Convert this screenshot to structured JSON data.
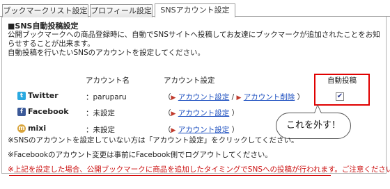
{
  "tabs": [
    {
      "label": "ブックマークリスト設定",
      "active": false
    },
    {
      "label": "プロフィール設定",
      "active": false
    },
    {
      "label": "SNSアカウント設定",
      "active": true
    }
  ],
  "section": {
    "title": "■SNS自動投稿設定",
    "desc_line1": "公開ブックマークへの商品登録時に、自動でSNSサイトへ投稿してお友達にブックマークが追加されたことをお知らせすることが出来ます。",
    "desc_line2": "自動投稿を行いたいSNSのアカウントを設定してください。"
  },
  "columns": {
    "account_name": "アカウント名",
    "account_settings": "アカウント設定",
    "auto_post": "自動投稿"
  },
  "services": [
    {
      "name": "Twitter",
      "icon": "twitter-icon",
      "account": "：paruparu",
      "settings_link": "アカウント設定",
      "delete_link": "アカウント削除",
      "auto_post_checked": true
    },
    {
      "name": "Facebook",
      "icon": "facebook-icon",
      "account": "：未設定",
      "settings_link": "アカウント設定"
    },
    {
      "name": "mixi",
      "icon": "mixi-icon",
      "account": "：未設定",
      "settings_link": "アカウント設定"
    }
  ],
  "annotation": {
    "bubble_text": "これを外す！",
    "highlight_color": "#e00000"
  },
  "notes": [
    "※SNSのアカウントを設定していない方は「アカウント設定」をクリックしてください。",
    "※Facebookのアカウント変更は事前にFacebook側でログアウトしてください。",
    "※上記を設定した場合、公開ブックマークに商品を追加したタイミングでSNSへの投稿が行われます。ご注意ください。"
  ],
  "colors": {
    "link": "#1a4dbf",
    "warning": "#cc1111"
  }
}
